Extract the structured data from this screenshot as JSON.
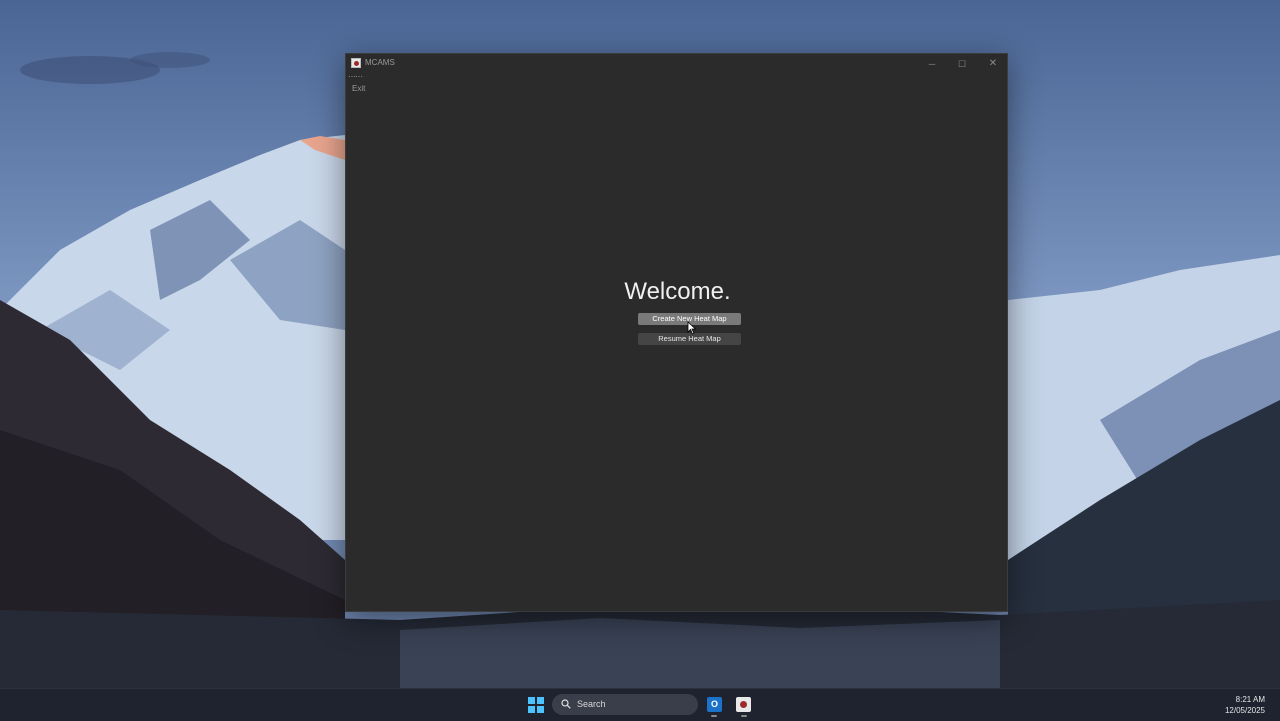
{
  "window": {
    "title": "MCAMS",
    "menu": {
      "handle": "⋯⋯",
      "exit_label": "Exit"
    },
    "controls": {
      "minimize": "─",
      "maximize": "☐",
      "close": "✕"
    }
  },
  "main": {
    "heading": "Welcome.",
    "create_button_label": "Create New Heat Map",
    "resume_button_label": "Resume Heat Map"
  },
  "taskbar": {
    "search_label": "Search",
    "outlook_glyph": "O",
    "apps": [
      "outlook-icon",
      "mcams-icon"
    ],
    "time": "8:21 AM",
    "date": "12/05/2025"
  },
  "colors": {
    "window_bg": "#2b2b2b",
    "primary_button": "#7a7a7a",
    "secondary_button": "#454545",
    "taskbar_bg": "#1f2330",
    "start_accent": "#4cc2ff"
  }
}
